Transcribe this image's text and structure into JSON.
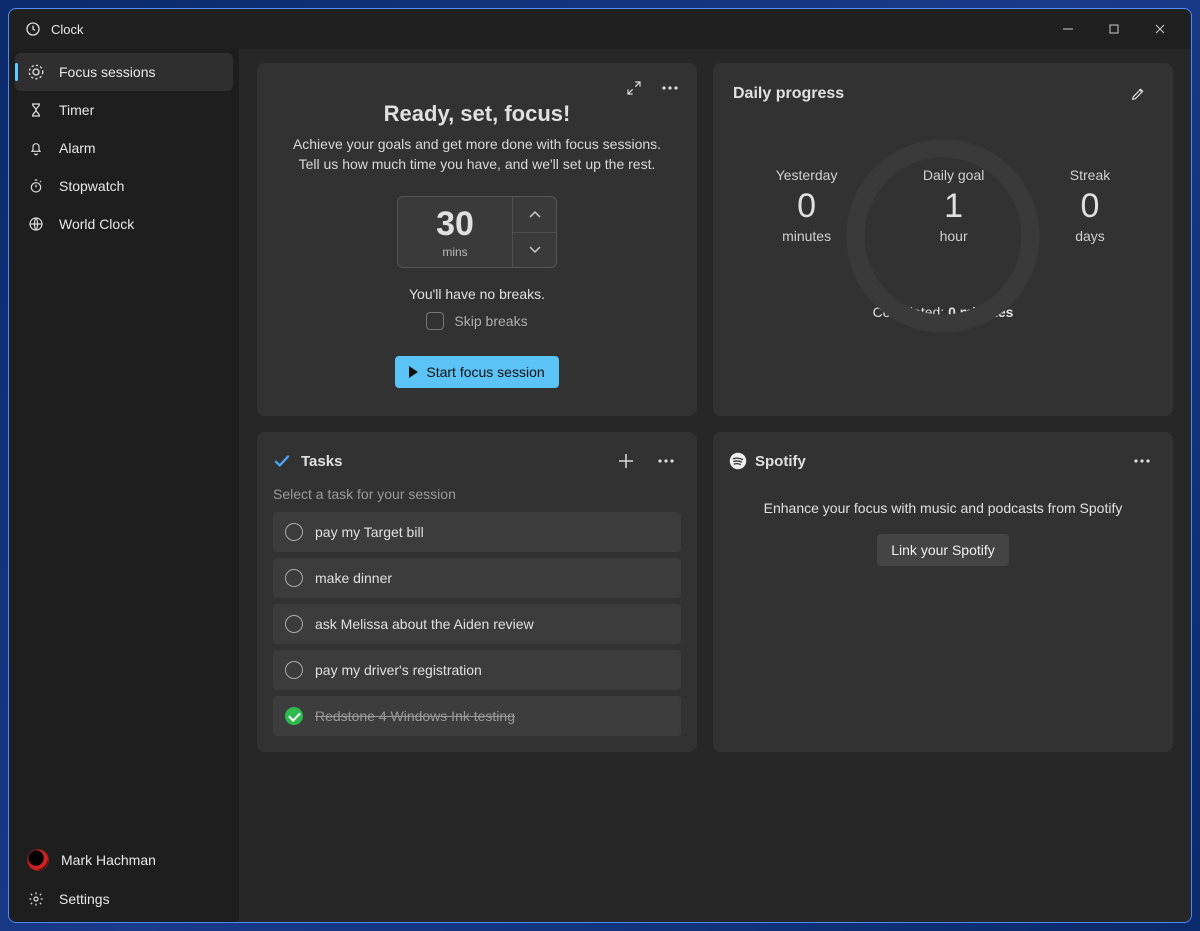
{
  "app": {
    "title": "Clock"
  },
  "window_controls": {
    "min": "–",
    "max": "▢",
    "close": "✕"
  },
  "nav": {
    "items": [
      {
        "label": "Focus sessions",
        "icon": "focus",
        "active": true
      },
      {
        "label": "Timer",
        "icon": "hourglass"
      },
      {
        "label": "Alarm",
        "icon": "bell"
      },
      {
        "label": "Stopwatch",
        "icon": "stopwatch"
      },
      {
        "label": "World Clock",
        "icon": "globe"
      }
    ]
  },
  "user": {
    "name": "Mark Hachman"
  },
  "settings_label": "Settings",
  "focus": {
    "heading": "Ready, set, focus!",
    "description": "Achieve your goals and get more done with focus sessions. Tell us how much time you have, and we'll set up the rest.",
    "minutes": "30",
    "minutes_unit": "mins",
    "break_note": "You'll have no breaks.",
    "skip_label": "Skip breaks",
    "start_label": "Start focus session"
  },
  "tasks": {
    "title": "Tasks",
    "subtitle": "Select a task for your session",
    "items": [
      {
        "label": "pay my Target bill",
        "done": false
      },
      {
        "label": "make dinner",
        "done": false
      },
      {
        "label": "ask Melissa about the Aiden review",
        "done": false
      },
      {
        "label": "pay my driver's registration",
        "done": false
      },
      {
        "label": "Redstone 4 Windows Ink testing",
        "done": true
      }
    ]
  },
  "progress": {
    "title": "Daily progress",
    "yesterday": {
      "label": "Yesterday",
      "value": "0",
      "unit": "minutes"
    },
    "goal": {
      "label": "Daily goal",
      "value": "1",
      "unit": "hour"
    },
    "streak": {
      "label": "Streak",
      "value": "0",
      "unit": "days"
    },
    "completed_prefix": "Completed: ",
    "completed_value": "0 minutes"
  },
  "spotify": {
    "brand": "Spotify",
    "message": "Enhance your focus with music and podcasts from Spotify",
    "link_label": "Link your Spotify"
  }
}
